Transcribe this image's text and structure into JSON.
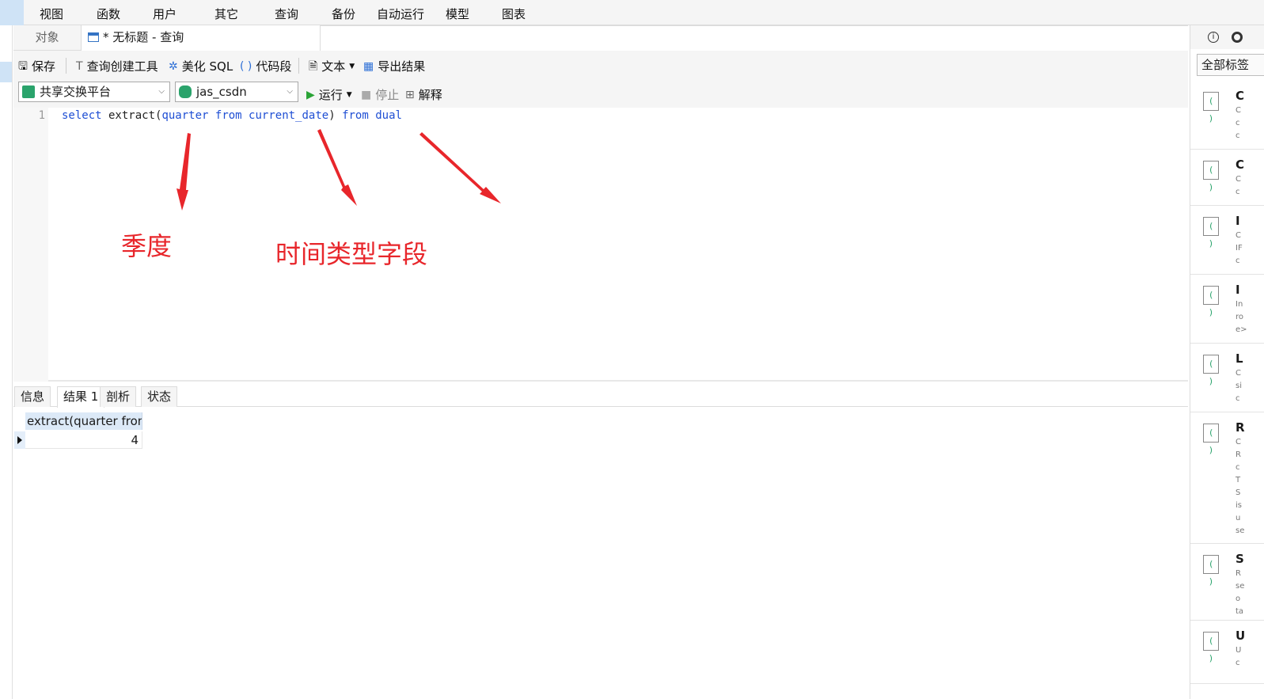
{
  "menu": {
    "items": [
      "视图",
      "函数",
      "用户",
      "其它",
      "查询",
      "备份",
      "自动运行",
      "模型",
      "图表"
    ]
  },
  "tabs": {
    "objects": "对象",
    "query_title": "* 无标题 - 查询"
  },
  "toolbar": {
    "save": "保存",
    "query_builder": "查询创建工具",
    "beautify": "美化 SQL",
    "snippet": "代码段",
    "text": "文本",
    "export": "导出结果"
  },
  "toolbar2": {
    "connection": "共享交换平台",
    "database": "jas_csdn",
    "run": "运行",
    "stop": "停止",
    "explain": "解释"
  },
  "editor": {
    "line_number": "1",
    "tokens": [
      {
        "t": "select",
        "k": "kw"
      },
      {
        "t": " extract(",
        "k": "tx"
      },
      {
        "t": "quarter",
        "k": "kw"
      },
      {
        "t": " ",
        "k": "tx"
      },
      {
        "t": "from",
        "k": "kw"
      },
      {
        "t": " ",
        "k": "tx"
      },
      {
        "t": "current_date",
        "k": "kw"
      },
      {
        "t": ") ",
        "k": "tx"
      },
      {
        "t": "from",
        "k": "kw"
      },
      {
        "t": " ",
        "k": "tx"
      },
      {
        "t": "dual",
        "k": "kw"
      }
    ]
  },
  "annotations": {
    "label_quarter": "季度",
    "label_time_field": "时间类型字段",
    "color": "#e8262b"
  },
  "result_tabs": [
    "信息",
    "结果 1",
    "剖析",
    "状态"
  ],
  "result": {
    "column_header": "extract(quarter from",
    "value": "4"
  },
  "right_panel": {
    "tag_button": "全部标签",
    "snippets": [
      {
        "title": "C",
        "lines": [
          "C",
          "c",
          "c"
        ]
      },
      {
        "title": "C",
        "lines": [
          "C",
          "c"
        ]
      },
      {
        "title": "I",
        "lines": [
          "C",
          "IF",
          "c"
        ]
      },
      {
        "title": "I",
        "lines": [
          "In",
          "ro",
          "e>"
        ]
      },
      {
        "title": "L",
        "lines": [
          "C",
          "si",
          "c"
        ]
      },
      {
        "title": "R",
        "lines": [
          "C",
          "R",
          "c",
          "T",
          "S",
          "is",
          "u",
          "se"
        ]
      },
      {
        "title": "S",
        "lines": [
          "R",
          "se",
          "o",
          "ta"
        ]
      },
      {
        "title": "U",
        "lines": [
          "U",
          "c"
        ]
      }
    ]
  }
}
